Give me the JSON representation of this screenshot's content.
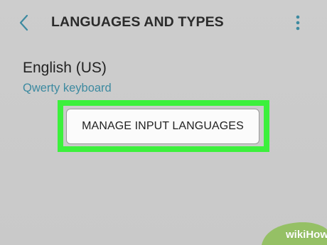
{
  "header": {
    "title": "LANGUAGES AND TYPES",
    "back_icon": "back-chevron-icon",
    "menu_icon": "more-vertical-icon"
  },
  "languages": [
    {
      "name": "English (US)",
      "keyboard": "Qwerty keyboard"
    }
  ],
  "actions": {
    "manage_label": "MANAGE INPUT LANGUAGES"
  },
  "watermark": {
    "text": "wikiHow"
  },
  "colors": {
    "background": "#c9c9c9",
    "accent": "#3d8aa0",
    "highlight": "#3cf03c",
    "button_bg": "#fbfbfb",
    "title_text": "#2b2b2b"
  }
}
